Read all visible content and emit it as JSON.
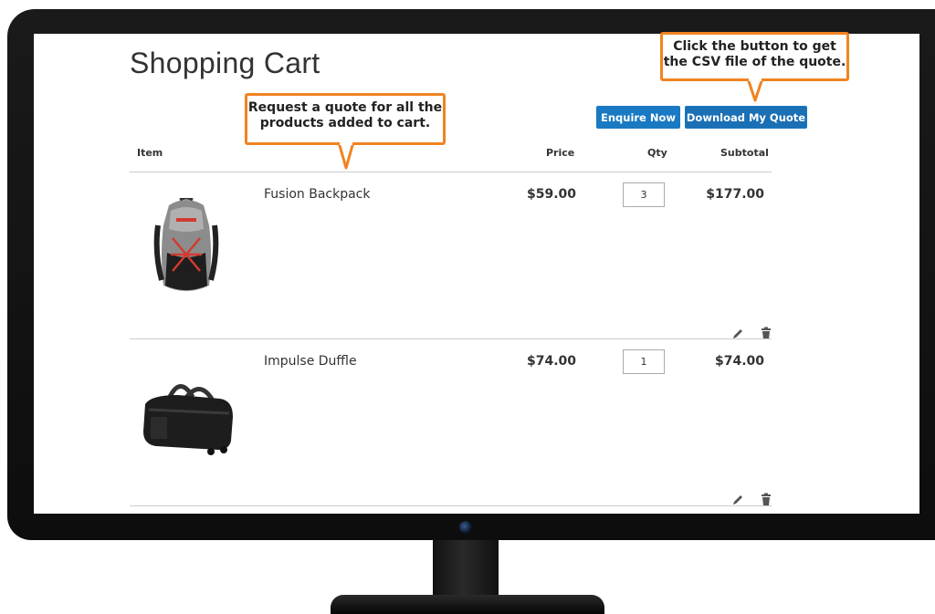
{
  "page": {
    "title": "Shopping Cart"
  },
  "buttons": {
    "enquire": "Enquire Now",
    "download": "Download My Quote"
  },
  "table": {
    "headers": {
      "item": "Item",
      "price": "Price",
      "qty": "Qty",
      "subtotal": "Subtotal"
    },
    "rows": [
      {
        "name": "Fusion Backpack",
        "price": "$59.00",
        "qty": "3",
        "subtotal": "$177.00",
        "image_icon": "backpack-image"
      },
      {
        "name": "Impulse Duffle",
        "price": "$74.00",
        "qty": "1",
        "subtotal": "$74.00",
        "image_icon": "duffle-bag-image"
      }
    ]
  },
  "callouts": {
    "quote": "Request a quote for all the products added to cart.",
    "csv": "Click the button to get the CSV file of the quote."
  },
  "colors": {
    "button_bg": "#1979c3",
    "callout_border": "#f08321"
  },
  "icons": {
    "edit": "pencil-icon",
    "delete": "trash-icon"
  }
}
